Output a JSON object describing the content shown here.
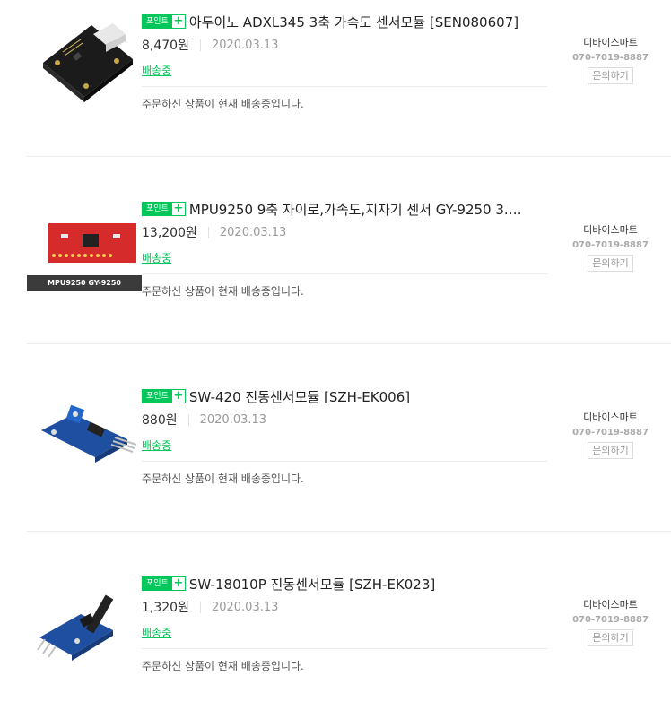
{
  "orders": [
    {
      "point_badge": "포인트",
      "title": "아두이노 ADXL345 3축 가속도 센서모듈 [SEN080607]",
      "price": "8,470원",
      "date": "2020.03.13",
      "status": "배송중",
      "description": "주문하신 상품이 현재 배송중입니다.",
      "seller": "디바이스마트",
      "phone": "070-7019-8887",
      "inquiry": "문의하기",
      "image_label": ""
    },
    {
      "point_badge": "포인트",
      "title": "MPU9250 9축 자이로,가속도,지자기 센서 GY-9250 3.…",
      "price": "13,200원",
      "date": "2020.03.13",
      "status": "배송중",
      "description": "주문하신 상품이 현재 배송중입니다.",
      "seller": "디바이스마트",
      "phone": "070-7019-8887",
      "inquiry": "문의하기",
      "image_label": "MPU9250 GY-9250"
    },
    {
      "point_badge": "포인트",
      "title": "SW-420 진동센서모듈 [SZH-EK006]",
      "price": "880원",
      "date": "2020.03.13",
      "status": "배송중",
      "description": "주문하신 상품이 현재 배송중입니다.",
      "seller": "디바이스마트",
      "phone": "070-7019-8887",
      "inquiry": "문의하기",
      "image_label": ""
    },
    {
      "point_badge": "포인트",
      "title": "SW-18010P 진동센서모듈 [SZH-EK023]",
      "price": "1,320원",
      "date": "2020.03.13",
      "status": "배송중",
      "description": "주문하신 상품이 현재 배송중입니다.",
      "seller": "디바이스마트",
      "phone": "070-7019-8887",
      "inquiry": "문의하기",
      "image_label": ""
    }
  ],
  "colors": {
    "accent_green": "#03c75a",
    "text_dark": "#222222",
    "text_muted": "#999999"
  },
  "icons": [
    "plus-icon",
    "product-thumbnail"
  ]
}
